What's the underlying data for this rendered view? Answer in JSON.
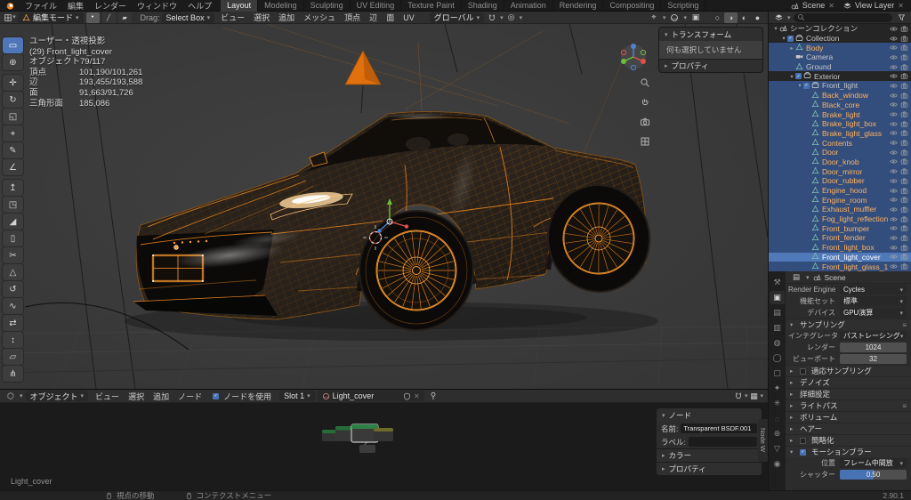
{
  "topbar": {
    "menus": [
      "ファイル",
      "編集",
      "レンダー",
      "ウィンドウ",
      "ヘルプ"
    ],
    "workspaces": [
      "Layout",
      "Modeling",
      "Sculpting",
      "UV Editing",
      "Texture Paint",
      "Shading",
      "Animation",
      "Rendering",
      "Compositing",
      "Scripting"
    ],
    "active_workspace": "Layout",
    "scene_name": "Scene",
    "view_layer_name": "View Layer"
  },
  "viewport": {
    "header": {
      "mode": "編集モード",
      "drag_label": "Drag:",
      "active_tool": "Select Box",
      "menus": [
        "ビュー",
        "選択",
        "追加",
        "メッシュ",
        "頂点",
        "辺",
        "面",
        "UV"
      ],
      "orientation": "グローバル"
    },
    "overlay": {
      "view_name": "ユーザー・透視投影",
      "active_object": "(29) Front_light_cover",
      "stats": [
        {
          "label": "オブジェクト",
          "value": "79/117"
        },
        {
          "label": "頂点",
          "value": "101,190/101,261"
        },
        {
          "label": "辺",
          "value": "193,455/193,588"
        },
        {
          "label": "面",
          "value": "91,663/91,726"
        },
        {
          "label": "三角形面",
          "value": "185,086"
        }
      ]
    },
    "npanel": {
      "transform_title": "トランスフォーム",
      "empty_message": "何も選択していません",
      "properties_title": "プロパティ"
    },
    "toolbar_tools": [
      "box-select",
      "cursor",
      "move",
      "rotate",
      "scale",
      "transform",
      "annotate",
      "measure",
      "extrude-region",
      "inset-faces",
      "bevel",
      "loop-cut",
      "knife",
      "poly-build",
      "spin",
      "smooth",
      "edge-slide",
      "shrink-fatten",
      "shear",
      "rip-region"
    ],
    "shading_modes": [
      "wireframe",
      "solid",
      "material-preview",
      "rendered"
    ],
    "active_shading": "solid"
  },
  "outliner": {
    "rows": [
      {
        "label": "シーンコレクション",
        "depth": 0,
        "icon": "scene",
        "disc": "open"
      },
      {
        "label": "Collection",
        "depth": 1,
        "icon": "col",
        "disc": "open",
        "checkbox": true
      },
      {
        "label": "Body",
        "depth": 2,
        "icon": "mesh",
        "disc": "closed",
        "selected": true,
        "orange": true
      },
      {
        "label": "Camera",
        "depth": 2,
        "icon": "vcam",
        "selected": true
      },
      {
        "label": "Ground",
        "depth": 2,
        "icon": "mesh",
        "selected": true
      },
      {
        "label": "Exterior",
        "depth": 2,
        "icon": "col",
        "disc": "open",
        "checkbox": true
      },
      {
        "label": "Front_light",
        "depth": 3,
        "icon": "col",
        "disc": "open",
        "checkbox": true,
        "selected": true
      },
      {
        "label": "Back_window",
        "depth": 4,
        "icon": "mesh",
        "selected": true,
        "orange": true
      },
      {
        "label": "Black_core",
        "depth": 4,
        "icon": "mesh",
        "selected": true,
        "orange": true
      },
      {
        "label": "Brake_light",
        "depth": 4,
        "icon": "mesh",
        "selected": true,
        "orange": true
      },
      {
        "label": "Brake_light_box",
        "depth": 4,
        "icon": "mesh",
        "selected": true,
        "orange": true
      },
      {
        "label": "Brake_light_glass",
        "depth": 4,
        "icon": "mesh",
        "selected": true,
        "orange": true
      },
      {
        "label": "Contents",
        "depth": 4,
        "icon": "mesh",
        "selected": true,
        "orange": true
      },
      {
        "label": "Door",
        "depth": 4,
        "icon": "mesh",
        "selected": true,
        "orange": true
      },
      {
        "label": "Door_knob",
        "depth": 4,
        "icon": "mesh",
        "selected": true,
        "orange": true
      },
      {
        "label": "Door_mirror",
        "depth": 4,
        "icon": "mesh",
        "selected": true,
        "orange": true
      },
      {
        "label": "Door_rubber",
        "depth": 4,
        "icon": "mesh",
        "selected": true,
        "orange": true
      },
      {
        "label": "Engine_hood",
        "depth": 4,
        "icon": "mesh",
        "selected": true,
        "orange": true
      },
      {
        "label": "Engine_room",
        "depth": 4,
        "icon": "mesh",
        "selected": true,
        "orange": true
      },
      {
        "label": "Exhaust_muffler",
        "depth": 4,
        "icon": "mesh",
        "selected": true,
        "orange": true
      },
      {
        "label": "Fog_light_reflection",
        "depth": 4,
        "icon": "mesh",
        "selected": true,
        "orange": true
      },
      {
        "label": "Front_bumper",
        "depth": 4,
        "icon": "mesh",
        "selected": true,
        "orange": true
      },
      {
        "label": "Front_fender",
        "depth": 4,
        "icon": "mesh",
        "selected": true,
        "orange": true
      },
      {
        "label": "Front_light_box",
        "depth": 4,
        "icon": "mesh",
        "selected": true,
        "orange": true
      },
      {
        "label": "Front_light_cover",
        "depth": 4,
        "icon": "mesh",
        "selected": true,
        "active": true
      },
      {
        "label": "Front_light_glass_1",
        "depth": 4,
        "icon": "mesh",
        "selected": true,
        "orange": true
      }
    ]
  },
  "properties": {
    "breadcrumb": "Scene",
    "tabs": [
      "tool",
      "render",
      "output",
      "view-layer",
      "scene",
      "world",
      "object",
      "modifiers",
      "particles",
      "physics",
      "constraints",
      "object-data",
      "material"
    ],
    "active_tab": "render",
    "rows": [
      {
        "t": "field",
        "label": "Render Engine",
        "value": "Cycles"
      },
      {
        "t": "field",
        "label": "機能セット",
        "value": "標準"
      },
      {
        "t": "field",
        "label": "デバイス",
        "value": "GPU演算"
      },
      {
        "t": "sec",
        "label": "サンプリング",
        "open": true,
        "menu": true
      },
      {
        "t": "field",
        "label": "インテグレータ",
        "value": "パストレーシング"
      },
      {
        "t": "num",
        "label": "レンダー",
        "value": "1024"
      },
      {
        "t": "num",
        "label": "ビューポート",
        "value": "32"
      },
      {
        "t": "sec",
        "label": "適応サンプリング",
        "check": "off"
      },
      {
        "t": "sec",
        "label": "デノイズ"
      },
      {
        "t": "sec",
        "label": "詳細設定"
      },
      {
        "t": "sec",
        "label": "ライトパス",
        "menu": true
      },
      {
        "t": "sec",
        "label": "ボリューム"
      },
      {
        "t": "sec",
        "label": "ヘアー"
      },
      {
        "t": "sec",
        "label": "簡略化",
        "check": "off"
      },
      {
        "t": "sec",
        "label": "モーションブラー",
        "open": true,
        "check": "on"
      },
      {
        "t": "field",
        "label": "位置",
        "value": "フレーム中間放"
      },
      {
        "t": "slider",
        "label": "シャッター",
        "value": "0.50",
        "frac": 0.5
      }
    ]
  },
  "node_editor": {
    "header": {
      "shader_scope": "オブジェクト",
      "menus": [
        "ビュー",
        "選択",
        "追加",
        "ノード"
      ],
      "use_nodes_label": "ノードを使用",
      "use_nodes_checked": true,
      "slot": "Slot 1",
      "material_name": "Light_cover"
    },
    "sidebar": {
      "title": "ノード",
      "name_label": "名前:",
      "name_value": "Transparent BSDF.001",
      "label_label": "ラベル:",
      "label_value": "",
      "sections": [
        "カラー",
        "プロパティ"
      ],
      "side_tab": "Node W"
    },
    "breadcrumb": "Light_cover"
  },
  "statusbar": {
    "hints": [
      "視点の移動",
      "コンテクストメニュー"
    ],
    "version": "2.90.1"
  }
}
